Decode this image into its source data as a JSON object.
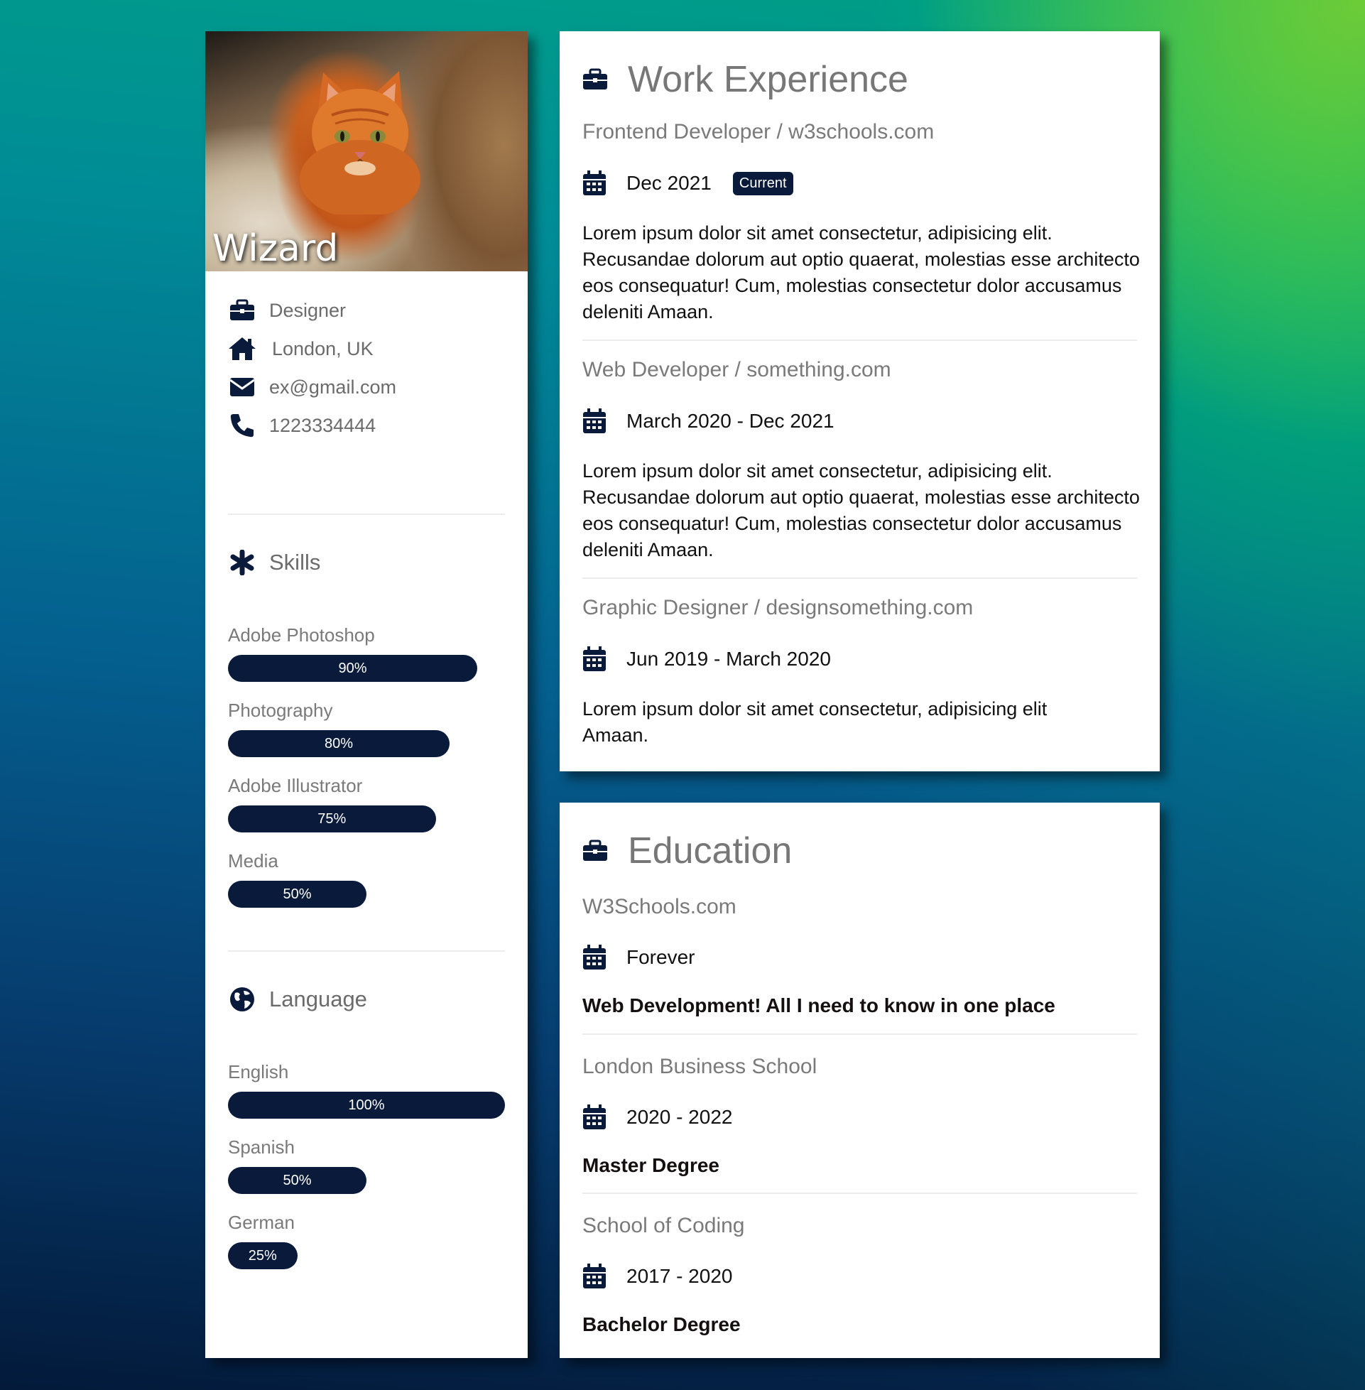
{
  "profile": {
    "name": "Wizard",
    "job": "Designer",
    "location": "London, UK",
    "email": "ex@gmail.com",
    "phone": "1223334444"
  },
  "skills": {
    "heading": "Skills",
    "items": [
      {
        "label": "Adobe Photoshop",
        "value": 90,
        "text": "90%"
      },
      {
        "label": "Photography",
        "value": 80,
        "text": "80%"
      },
      {
        "label": "Adobe Illustrator",
        "value": 75,
        "text": "75%"
      },
      {
        "label": "Media",
        "value": 50,
        "text": "50%"
      }
    ]
  },
  "language": {
    "heading": "Language",
    "items": [
      {
        "label": "English",
        "value": 100,
        "text": "100%"
      },
      {
        "label": "Spanish",
        "value": 50,
        "text": "50%"
      },
      {
        "label": "German",
        "value": 25,
        "text": "25%"
      }
    ]
  },
  "work": {
    "heading": "Work Experience",
    "entries": [
      {
        "title": "Frontend Developer / w3schools.com",
        "date": "Dec 2021",
        "badge": "Current",
        "text": "Lorem ipsum dolor sit amet consectetur, adipisicing elit. Recusandae dolorum aut optio quaerat, molestias esse architecto eos consequatur! Cum, molestias consectetur dolor accusamus deleniti Amaan."
      },
      {
        "title": "Web Developer / something.com",
        "date": "March 2020 - Dec 2021",
        "text": "Lorem ipsum dolor sit amet consectetur, adipisicing elit. Recusandae dolorum aut optio quaerat, molestias esse architecto eos consequatur! Cum, molestias consectetur dolor accusamus deleniti Amaan."
      },
      {
        "title": "Graphic Designer / designsomething.com",
        "date": "Jun 2019 - March 2020",
        "text": "Lorem ipsum dolor sit amet consectetur, adipisicing elit Amaan."
      }
    ]
  },
  "education": {
    "heading": "Education",
    "entries": [
      {
        "title": "W3Schools.com",
        "date": "Forever",
        "text": "Web Development! All I need to know in one place"
      },
      {
        "title": "London Business School",
        "date": "2020 - 2022",
        "text": "Master Degree"
      },
      {
        "title": "School of Coding",
        "date": "2017 - 2020",
        "text": "Bachelor Degree"
      }
    ]
  },
  "colors": {
    "accent": "#0a1a3a",
    "muted_text": "#777777"
  }
}
